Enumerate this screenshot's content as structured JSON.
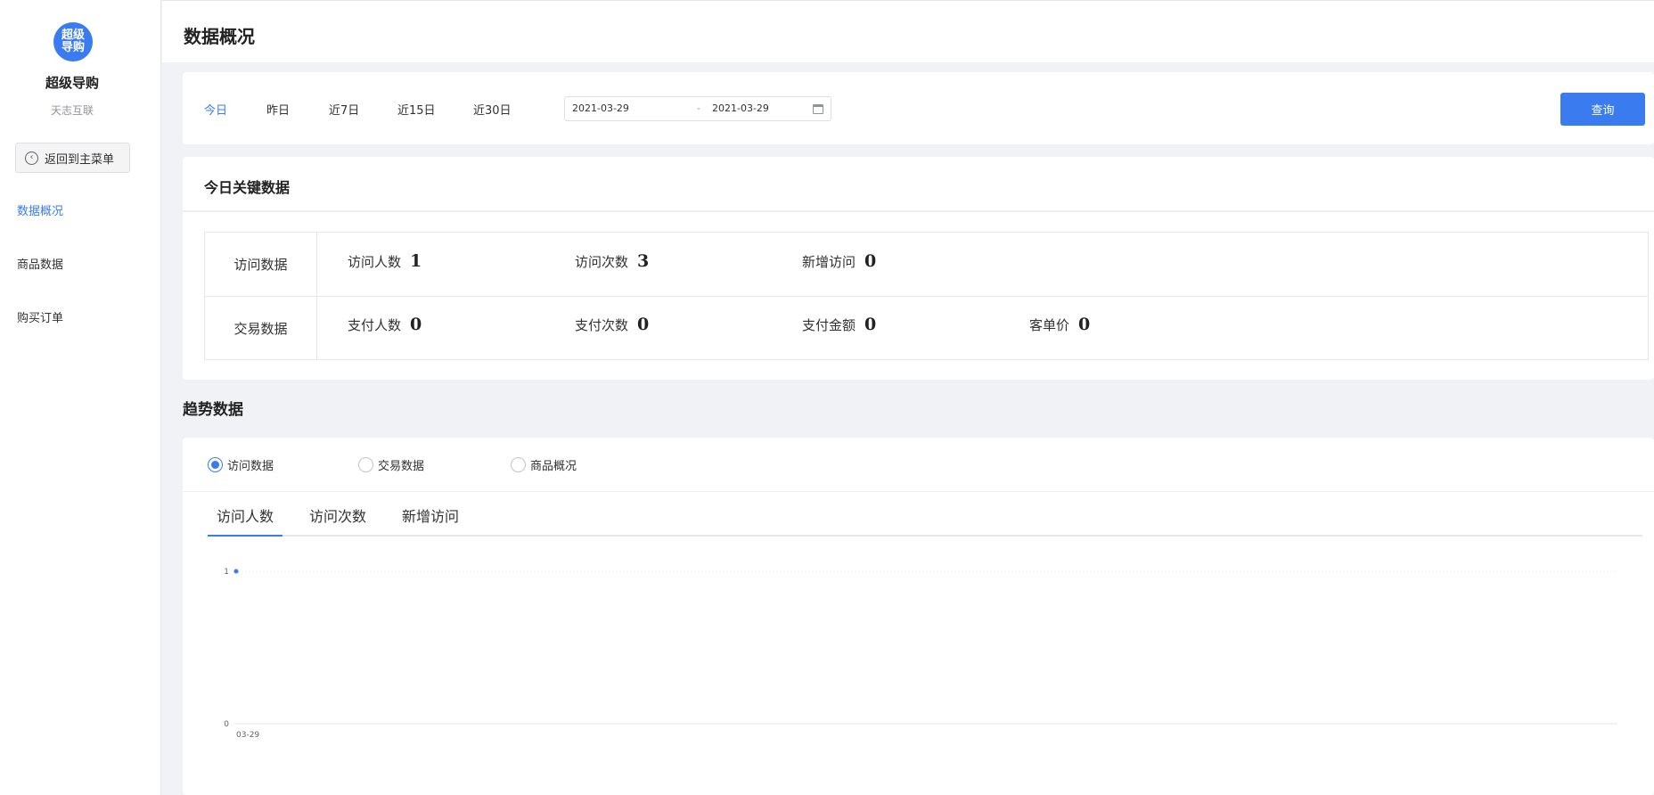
{
  "sidebar": {
    "logo_text": "超级导购",
    "app_name": "超级导购",
    "company": "天志互联",
    "back_label": "返回到主菜单",
    "items": [
      {
        "label": "数据概况"
      },
      {
        "label": "商品数据"
      },
      {
        "label": "购买订单"
      }
    ]
  },
  "header": {
    "title": "数据概况"
  },
  "filter": {
    "tabs": [
      "今日",
      "昨日",
      "近7日",
      "近15日",
      "近30日"
    ],
    "start_date": "2021-03-29",
    "separator": "-",
    "end_date": "2021-03-29",
    "query_label": "查询"
  },
  "key_data": {
    "title": "今日关键数据",
    "rows": [
      {
        "label": "访问数据",
        "metrics": [
          {
            "name": "访问人数",
            "value": "1"
          },
          {
            "name": "访问次数",
            "value": "3"
          },
          {
            "name": "新增访问",
            "value": "0"
          }
        ]
      },
      {
        "label": "交易数据",
        "metrics": [
          {
            "name": "支付人数",
            "value": "0"
          },
          {
            "name": "支付次数",
            "value": "0"
          },
          {
            "name": "支付金额",
            "value": "0"
          },
          {
            "name": "客单价",
            "value": "0"
          }
        ]
      }
    ]
  },
  "trend": {
    "title": "趋势数据",
    "radios": [
      {
        "label": "访问数据",
        "checked": true
      },
      {
        "label": "交易数据",
        "checked": false
      },
      {
        "label": "商品概况",
        "checked": false
      }
    ],
    "metric_tabs": [
      "访问人数",
      "访问次数",
      "新增访问"
    ]
  },
  "chart_data": {
    "type": "line",
    "categories": [
      "03-29"
    ],
    "series": [
      {
        "values": [
          1
        ]
      }
    ],
    "yticks": [
      "1",
      "0"
    ],
    "ylim": [
      0,
      1
    ],
    "color": "#3a7bf0"
  }
}
